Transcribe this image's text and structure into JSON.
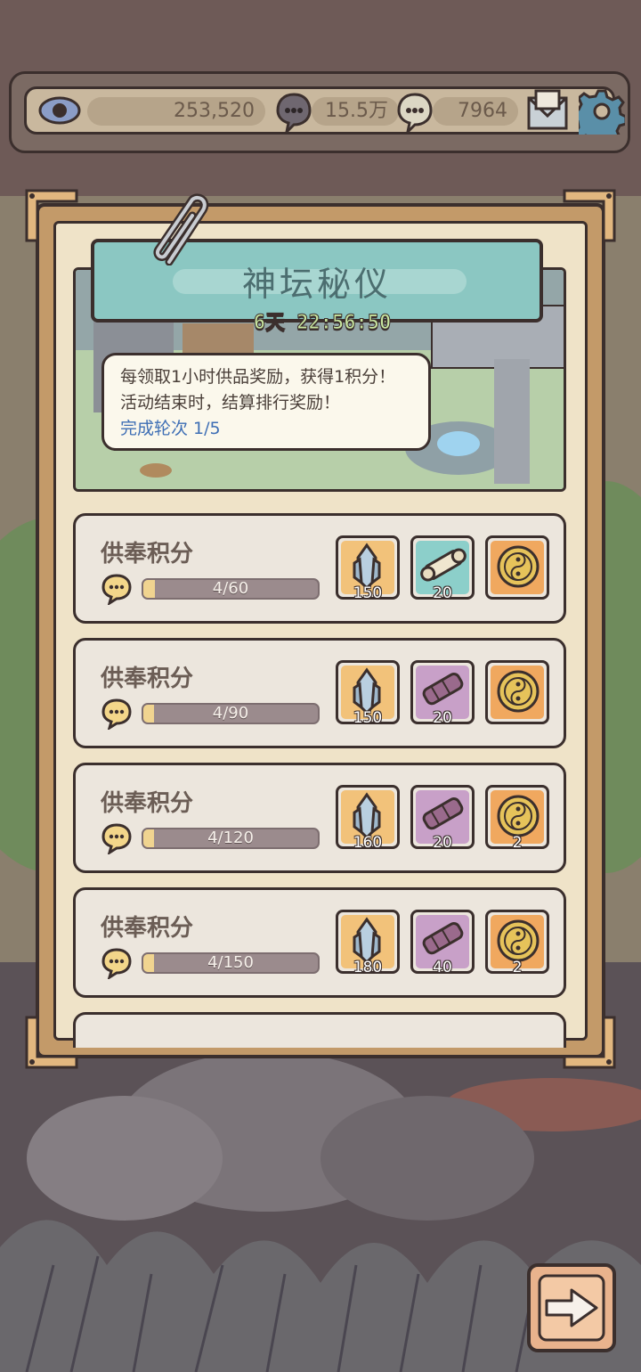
{
  "topbar": {
    "resources": [
      {
        "icon": "eye-icon",
        "value": "253,520"
      },
      {
        "icon": "speech-bubble-icon",
        "value": "15.5万"
      },
      {
        "icon": "gem-bubble-icon",
        "value": "7964"
      }
    ],
    "mail_icon": "mail-icon",
    "settings_icon": "gear-icon"
  },
  "event": {
    "title": "神坛秘仪",
    "timer": "6天 22:56:50",
    "desc_line1": "每领取1小时供品奖励，获得1积分！",
    "desc_line2": "活动结束时，结算排行奖励！",
    "desc_line3": "完成轮次 1/5"
  },
  "rows": [
    {
      "title": "供奉积分",
      "progress_text": "4/60",
      "progress": 0.067,
      "rewards": [
        {
          "icon": "crystal-icon",
          "qty": "150",
          "bg": "#f2c27a"
        },
        {
          "icon": "scroll-icon",
          "qty": "20",
          "bg": "#8ccfca"
        },
        {
          "icon": "yin-yang-coin-icon",
          "qty": "",
          "bg": "#f0a85f"
        }
      ]
    },
    {
      "title": "供奉积分",
      "progress_text": "4/90",
      "progress": 0.044,
      "rewards": [
        {
          "icon": "crystal-icon",
          "qty": "150",
          "bg": "#f2c27a"
        },
        {
          "icon": "cannon-icon",
          "qty": "20",
          "bg": "#c8a0c8"
        },
        {
          "icon": "yin-yang-coin-icon",
          "qty": "",
          "bg": "#f0a85f"
        }
      ]
    },
    {
      "title": "供奉积分",
      "progress_text": "4/120",
      "progress": 0.033,
      "rewards": [
        {
          "icon": "crystal-icon",
          "qty": "160",
          "bg": "#f2c27a"
        },
        {
          "icon": "cannon-icon",
          "qty": "20",
          "bg": "#c8a0c8"
        },
        {
          "icon": "yin-yang-coin-icon",
          "qty": "2",
          "bg": "#f0a85f"
        }
      ]
    },
    {
      "title": "供奉积分",
      "progress_text": "4/150",
      "progress": 0.027,
      "rewards": [
        {
          "icon": "crystal-icon",
          "qty": "180",
          "bg": "#f2c27a"
        },
        {
          "icon": "cannon-icon",
          "qty": "40",
          "bg": "#c8a0c8"
        },
        {
          "icon": "yin-yang-coin-icon",
          "qty": "2",
          "bg": "#f0a85f"
        }
      ]
    }
  ],
  "next_button_icon": "arrow-right-icon"
}
